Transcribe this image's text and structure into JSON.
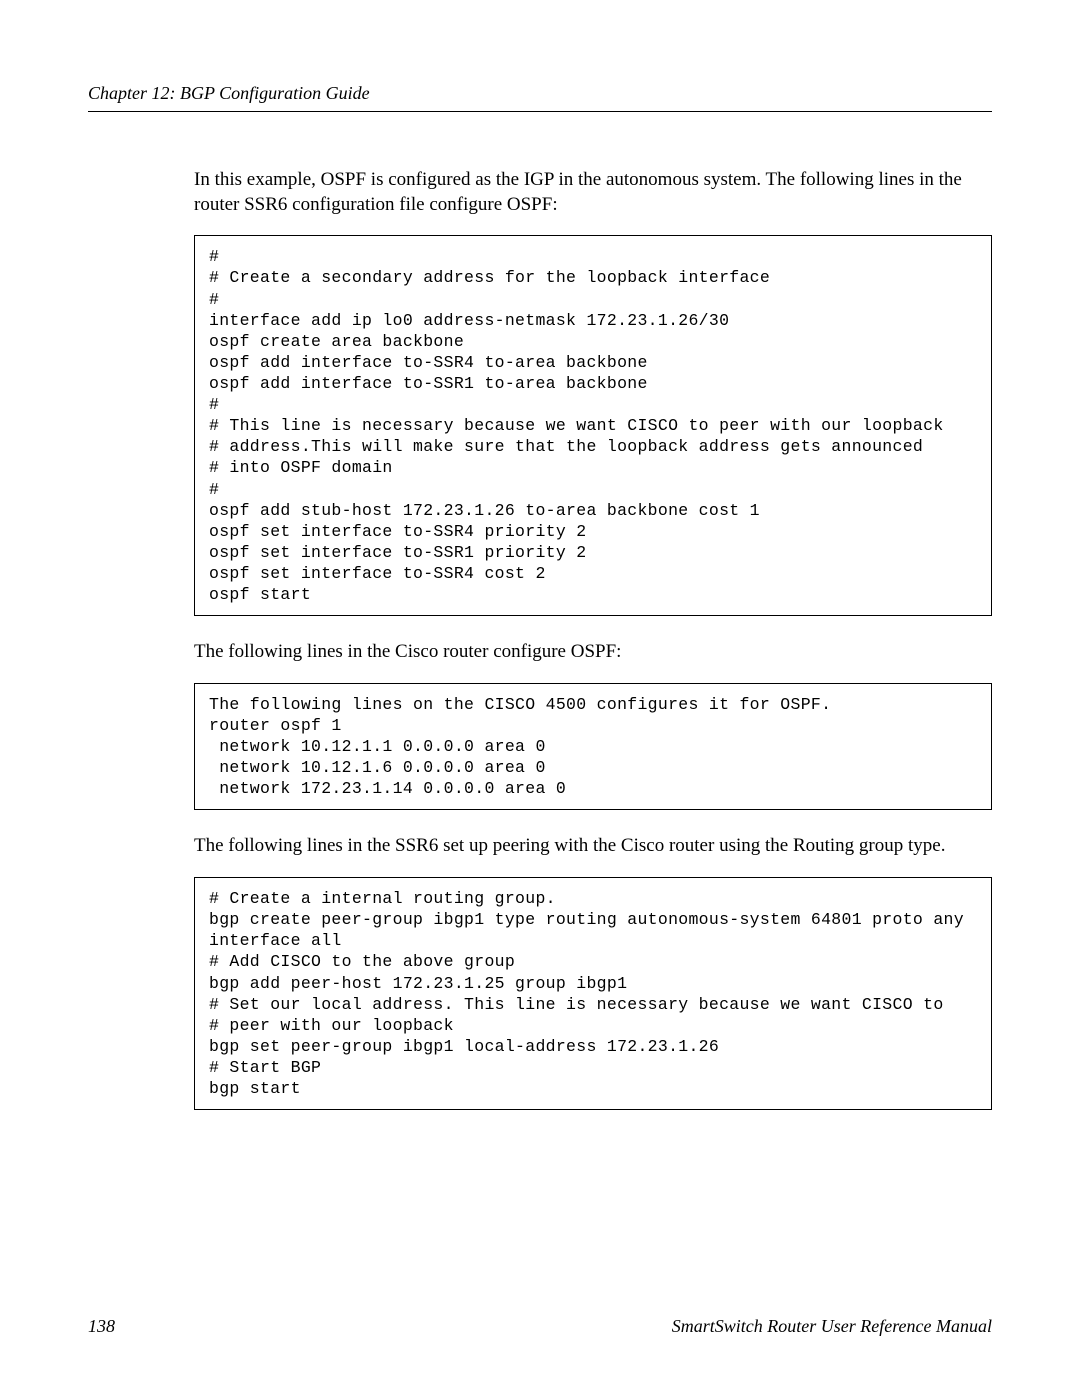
{
  "header": {
    "chapter_label": "Chapter 12: BGP Configuration Guide"
  },
  "body": {
    "para1": "In this example, OSPF is configured as the IGP in the autonomous system. The following lines in the router SSR6 configuration file configure OSPF:",
    "code1": "#\n# Create a secondary address for the loopback interface\n#\ninterface add ip lo0 address-netmask 172.23.1.26/30\nospf create area backbone\nospf add interface to-SSR4 to-area backbone\nospf add interface to-SSR1 to-area backbone\n#\n# This line is necessary because we want CISCO to peer with our loopback\n# address.This will make sure that the loopback address gets announced\n# into OSPF domain\n#\nospf add stub-host 172.23.1.26 to-area backbone cost 1\nospf set interface to-SSR4 priority 2\nospf set interface to-SSR1 priority 2\nospf set interface to-SSR4 cost 2\nospf start",
    "para2": "The following lines in the Cisco router configure OSPF:",
    "code2": "The following lines on the CISCO 4500 configures it for OSPF.\nrouter ospf 1\n network 10.12.1.1 0.0.0.0 area 0\n network 10.12.1.6 0.0.0.0 area 0\n network 172.23.1.14 0.0.0.0 area 0",
    "para3": "The following lines in the SSR6 set up peering with the Cisco router using the Routing group type.",
    "code3": "# Create a internal routing group.\nbgp create peer-group ibgp1 type routing autonomous-system 64801 proto any\ninterface all\n# Add CISCO to the above group\nbgp add peer-host 172.23.1.25 group ibgp1\n# Set our local address. This line is necessary because we want CISCO to\n# peer with our loopback\nbgp set peer-group ibgp1 local-address 172.23.1.26\n# Start BGP\nbgp start"
  },
  "footer": {
    "page_number": "138",
    "manual_title": "SmartSwitch Router User Reference Manual"
  }
}
